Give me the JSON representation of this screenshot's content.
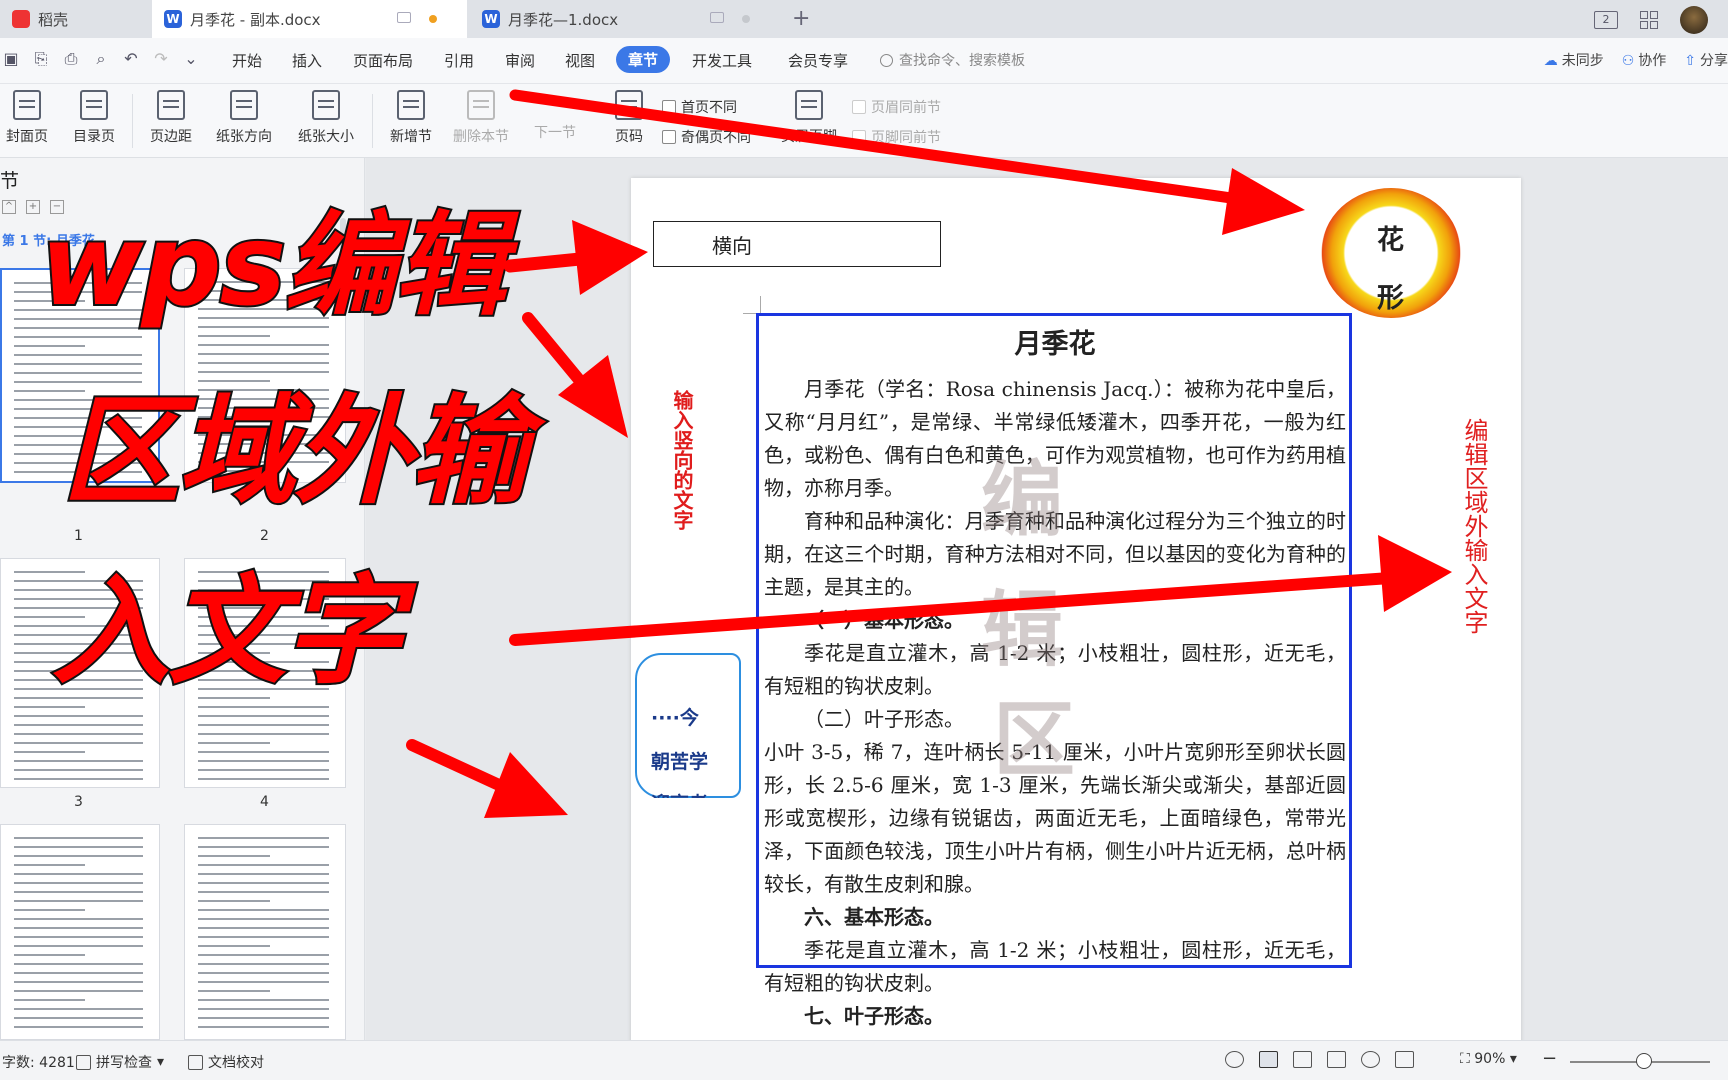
{
  "tabs": [
    {
      "label": "稻壳"
    },
    {
      "label": "月季花 - 副本.docx"
    },
    {
      "label": "月季花—1.docx"
    }
  ],
  "menu": [
    "开始",
    "插入",
    "页面布局",
    "引用",
    "审阅",
    "视图",
    "章节",
    "开发工具",
    "会员专享"
  ],
  "search": {
    "placeholder": "查找命令、搜索模板"
  },
  "right_menu": [
    "未同步",
    "协作",
    "分享"
  ],
  "ribbon": {
    "cover": "封面页",
    "toc": "目录页",
    "margin": "页边距",
    "orientation": "纸张方向",
    "size": "纸张大小",
    "new_section": "新增节",
    "delete_section": "删除本节",
    "next_section": "下一节",
    "page_number": "页码",
    "first_page_diff": "首页不同",
    "odd_even": "奇偶页不同",
    "header_footer": "页眉页脚",
    "header_same": "页眉同前节",
    "footer_same": "页脚同前节"
  },
  "leftpanel": {
    "title": "节",
    "section_label": "第 1 节: 月季花",
    "page_numbers": [
      "1",
      "2",
      "3",
      "4"
    ]
  },
  "overlay": {
    "line1": "wps编辑",
    "line2": "区域外输",
    "line3": "入文字"
  },
  "doc": {
    "textbox_horizontal": "横向",
    "vertical_left": "输入竖向的文字",
    "vertical_right": "编辑区域外输入文字",
    "flower_text": [
      "花",
      "形"
    ],
    "deco_text": [
      "····今",
      "朝苦学",
      "迎高考"
    ],
    "watermark": [
      "编",
      "辑",
      "区"
    ],
    "title": "月季花",
    "p1": "月季花（学名：Rosa chinensis Jacq.）：被称为花中皇后，又称“月月红”，是常绿、半常绿低矮灌木，四季开花，一般为红色，或粉色、偶有白色和黄色，可作为观赏植物，也可作为药用植物，亦称月季。",
    "p2": "育种和品种演化：月季育种和品种演化过程分为三个独立的时期，在这三个时期，育种方法相对不同，但以基因的变化为育种的主题，是其主的。",
    "h1": "（一）基本形态。",
    "p3": "季花是直立灌木，高 1-2 米；小枝粗壮，圆柱形，近无毛，有短粗的钩状皮刺。",
    "h2": "（二）叶子形态。",
    "p4": "小叶 3-5，稀 7，连叶柄长 5-11 厘米，小叶片宽卵形至卵状长圆形，长 2.5-6 厘米，宽 1-3 厘米，先端长渐尖或渐尖，基部近圆形或宽楔形，边缘有锐锯齿，两面近无毛，上面暗绿色，常带光泽，下面颜色较浅，顶生小叶片有柄，侧生小叶片近无柄，总叶柄较长，有散生皮刺和腺。",
    "h3": "六、基本形态。",
    "p5": "季花是直立灌木，高 1-2 米；小枝粗壮，圆柱形，近无毛，有短粗的钩状皮刺。",
    "h4": "七、叶子形态。"
  },
  "status": {
    "word_count": "字数: 4281",
    "spell": "拼写检查",
    "proof": "文档校对",
    "zoom": "90%"
  },
  "colors": {
    "accent": "#3b78e7",
    "arrow": "#ff0000",
    "text_box_border": "#1a35e0"
  }
}
